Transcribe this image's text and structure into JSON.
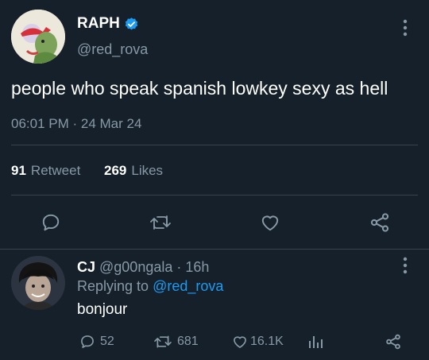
{
  "tweet": {
    "author_name": "RAPH",
    "author_handle": "@red_rova",
    "text": "people who speak spanish lowkey sexy as hell",
    "timestamp": "06:01 PM · 24 Mar 24",
    "retweet_count": "91",
    "retweet_label": "Retweet",
    "like_count": "269",
    "like_label": "Likes"
  },
  "reply": {
    "author_name": "CJ",
    "author_handle": "@g00ngala",
    "time": "· 16h",
    "replying_to_label": "Replying to",
    "replying_to_handle": "@red_rova",
    "text": "bonjour",
    "reply_count": "52",
    "retweet_count": "681",
    "like_count": "16.1K"
  },
  "colors": {
    "background": "#15202b",
    "accent": "#1d9bf0",
    "muted": "#8899a6",
    "divider": "#38444d"
  }
}
